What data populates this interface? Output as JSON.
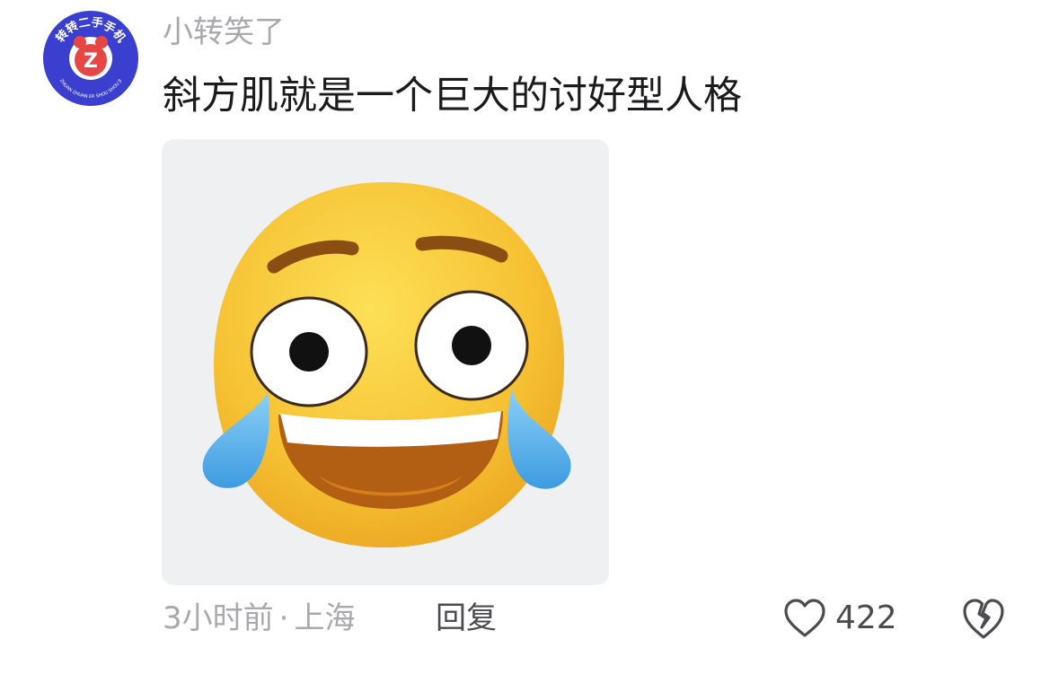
{
  "comment": {
    "avatar": {
      "icon": "zhuanzhuan-logo-icon",
      "badge_text_top": "转转二手手机",
      "badge_text_bottom": "ZHUAN ZHUAN ER SHOU SHOU JI",
      "badge_letter": "Z",
      "colors": {
        "ring": "#3a3fd0",
        "center": "#ffffff",
        "mark": "#e84545"
      }
    },
    "username": "小转笑了",
    "text": "斜方肌就是一个巨大的讨好型人格",
    "sticker": {
      "icon": "laughing-crying-emoji-icon",
      "colors": {
        "face": "#f6c233",
        "tears": "#5ab4ec",
        "background": "#eff0f1"
      }
    },
    "meta": {
      "time": "3小时前",
      "separator": "·",
      "location": "上海"
    },
    "reply_label": "回复",
    "like": {
      "icon": "heart-outline-icon",
      "count": "422"
    },
    "dislike": {
      "icon": "broken-heart-icon"
    }
  }
}
